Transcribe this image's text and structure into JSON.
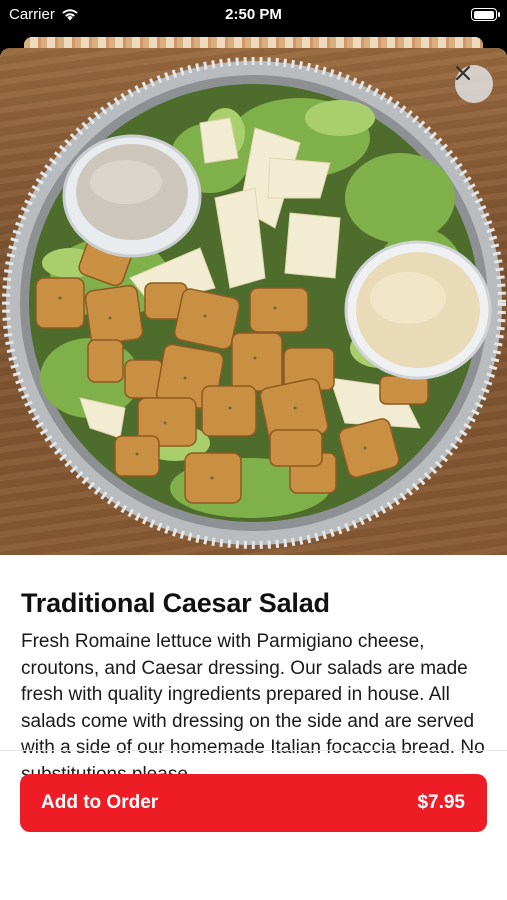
{
  "status_bar": {
    "carrier": "Carrier",
    "time": "2:50 PM",
    "battery_level": 1.0
  },
  "item": {
    "image_alt": "Traditional Caesar Salad in a foil tray",
    "title": "Traditional Caesar Salad",
    "description": "Fresh Romaine lettuce with Parmigiano cheese, croutons, and Caesar dressing. Our salads are made fresh with quality ingredients prepared in house. All salads come with dressing on the side and are served with a side of our homemade Italian focaccia bread. No substitutions please"
  },
  "actions": {
    "add_label": "Add to Order",
    "price": "$7.95",
    "close_icon": "close-icon"
  },
  "colors": {
    "accent": "#ee1c25",
    "background": "#ffffff",
    "text": "#111111"
  }
}
